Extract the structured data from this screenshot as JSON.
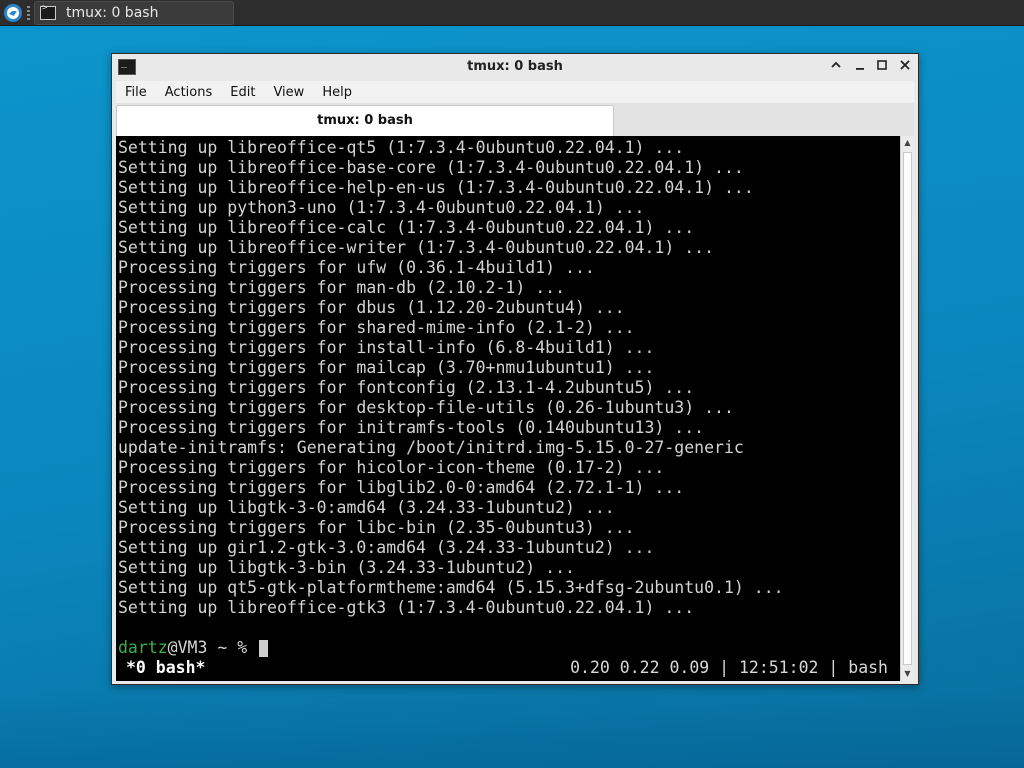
{
  "panel": {
    "task_label": "tmux: 0 bash"
  },
  "window": {
    "title": "tmux: 0 bash",
    "controls": {
      "minimize_icon": "chevron-up-icon",
      "restore_icon": "minimize-icon",
      "maximize_icon": "maximize-icon",
      "close_icon": "close-icon"
    }
  },
  "menubar": {
    "items": [
      "File",
      "Actions",
      "Edit",
      "View",
      "Help"
    ]
  },
  "tabs": [
    {
      "label": "tmux: 0 bash"
    }
  ],
  "terminal": {
    "lines": [
      "Setting up libreoffice-qt5 (1:7.3.4-0ubuntu0.22.04.1) ...",
      "Setting up libreoffice-base-core (1:7.3.4-0ubuntu0.22.04.1) ...",
      "Setting up libreoffice-help-en-us (1:7.3.4-0ubuntu0.22.04.1) ...",
      "Setting up python3-uno (1:7.3.4-0ubuntu0.22.04.1) ...",
      "Setting up libreoffice-calc (1:7.3.4-0ubuntu0.22.04.1) ...",
      "Setting up libreoffice-writer (1:7.3.4-0ubuntu0.22.04.1) ...",
      "Processing triggers for ufw (0.36.1-4build1) ...",
      "Processing triggers for man-db (2.10.2-1) ...",
      "Processing triggers for dbus (1.12.20-2ubuntu4) ...",
      "Processing triggers for shared-mime-info (2.1-2) ...",
      "Processing triggers for install-info (6.8-4build1) ...",
      "Processing triggers for mailcap (3.70+nmu1ubuntu1) ...",
      "Processing triggers for fontconfig (2.13.1-4.2ubuntu5) ...",
      "Processing triggers for desktop-file-utils (0.26-1ubuntu3) ...",
      "Processing triggers for initramfs-tools (0.140ubuntu13) ...",
      "update-initramfs: Generating /boot/initrd.img-5.15.0-27-generic",
      "Processing triggers for hicolor-icon-theme (0.17-2) ...",
      "Processing triggers for libglib2.0-0:amd64 (2.72.1-1) ...",
      "Setting up libgtk-3-0:amd64 (3.24.33-1ubuntu2) ...",
      "Processing triggers for libc-bin (2.35-0ubuntu3) ...",
      "Setting up gir1.2-gtk-3.0:amd64 (3.24.33-1ubuntu2) ...",
      "Setting up libgtk-3-bin (3.24.33-1ubuntu2) ...",
      "Setting up qt5-gtk-platformtheme:amd64 (5.15.3+dfsg-2ubuntu0.1) ...",
      "Setting up libreoffice-gtk3 (1:7.3.4-0ubuntu0.22.04.1) ..."
    ],
    "prompt": {
      "user": "dartz",
      "rest": "@VM3 ~ % "
    },
    "status": {
      "left": "*0 bash*",
      "right": "0.20 0.22 0.09 | 12:51:02 | bash"
    }
  }
}
